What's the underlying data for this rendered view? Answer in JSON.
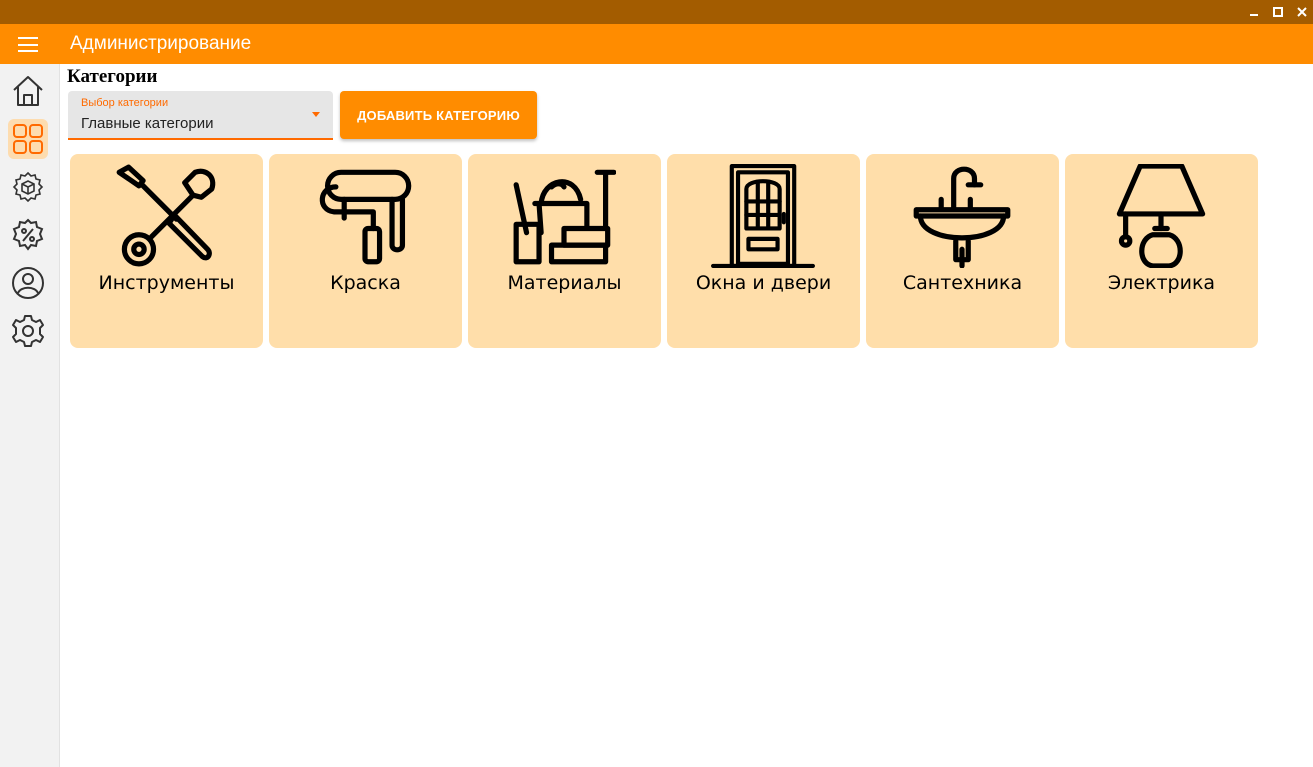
{
  "window": {
    "minimize_icon": "minimize-icon",
    "maximize_icon": "maximize-icon",
    "close_icon": "close-icon"
  },
  "appbar": {
    "title": "Администрирование",
    "menu_icon": "hamburger-menu-icon"
  },
  "sidebar": {
    "items": [
      {
        "icon": "home-icon",
        "active": false
      },
      {
        "icon": "grid-icon",
        "active": true
      },
      {
        "icon": "gear-box-icon",
        "active": false
      },
      {
        "icon": "percent-badge-icon",
        "active": false
      },
      {
        "icon": "user-icon",
        "active": false
      },
      {
        "icon": "settings-icon",
        "active": false
      }
    ]
  },
  "page": {
    "title": "Категории"
  },
  "category_select": {
    "label": "Выбор категории",
    "value": "Главные категории"
  },
  "add_button": {
    "label": "ДОБАВИТЬ КАТЕГОРИЮ"
  },
  "categories": [
    {
      "label": "Инструменты",
      "icon": "tools-icon"
    },
    {
      "label": "Краска",
      "icon": "paint-roller-icon"
    },
    {
      "label": "Материалы",
      "icon": "materials-icon"
    },
    {
      "label": "Окна и двери",
      "icon": "door-icon"
    },
    {
      "label": "Сантехника",
      "icon": "sink-icon"
    },
    {
      "label": "Электрика",
      "icon": "lamp-icon"
    }
  ],
  "colors": {
    "titlebar": "#a35c00",
    "appbar": "#ff8c00",
    "accent": "#ff6a00",
    "card": "#ffdeaa",
    "active_nav": "#fddcaf"
  }
}
